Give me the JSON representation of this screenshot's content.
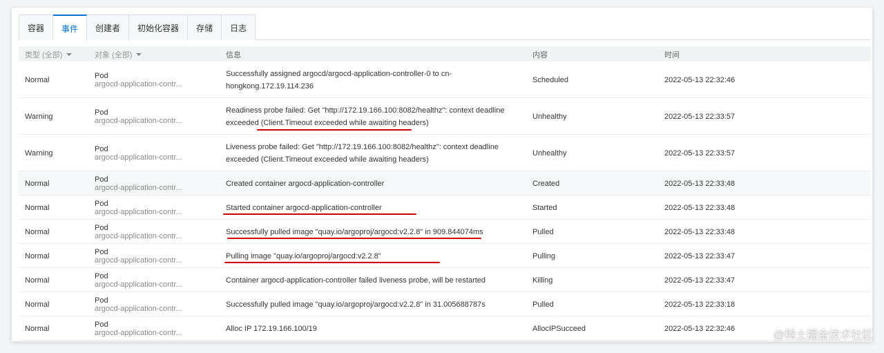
{
  "tabs": [
    {
      "label": "容器",
      "active": false
    },
    {
      "label": "事件",
      "active": true
    },
    {
      "label": "创建者",
      "active": false
    },
    {
      "label": "初始化容器",
      "active": false
    },
    {
      "label": "存储",
      "active": false
    },
    {
      "label": "日志",
      "active": false
    }
  ],
  "columns": {
    "type": "类型 (全部)",
    "object": "对象 (全部)",
    "info": "信息",
    "content": "内容",
    "time": "时间"
  },
  "events": [
    {
      "type": "Normal",
      "obj_kind": "Pod",
      "obj_name": "argocd-application-contr...",
      "info_line1": "Successfully assigned argocd/argocd-application-controller-0 to cn-",
      "info_line2": "hongkong.172.19.114.236",
      "content": "Scheduled",
      "time": "2022-05-13 22:32:46"
    },
    {
      "type": "Warning",
      "obj_kind": "Pod",
      "obj_name": "argocd-application-contr...",
      "info_line1": "Readiness probe failed: Get \"http://172.19.166.100:8082/healthz\": context deadline",
      "info_line2": "exceeded (Client.Timeout exceeded while awaiting headers)",
      "content": "Unhealthy",
      "time": "2022-05-13 22:33:57"
    },
    {
      "type": "Warning",
      "obj_kind": "Pod",
      "obj_name": "argocd-application-contr...",
      "info_line1": "Liveness probe failed: Get \"http://172.19.166.100:8082/healthz\": context deadline",
      "info_line2": "exceeded (Client.Timeout exceeded while awaiting headers)",
      "content": "Unhealthy",
      "time": "2022-05-13 22:33:57"
    },
    {
      "type": "Normal",
      "obj_kind": "Pod",
      "obj_name": "argocd-application-contr...",
      "info_line1": "Created container argocd-application-controller",
      "info_line2": "",
      "content": "Created",
      "time": "2022-05-13 22:33:48"
    },
    {
      "type": "Normal",
      "obj_kind": "Pod",
      "obj_name": "argocd-application-contr...",
      "info_line1": "Started container argocd-application-controller",
      "info_line2": "",
      "content": "Started",
      "time": "2022-05-13 22:33:48"
    },
    {
      "type": "Normal",
      "obj_kind": "Pod",
      "obj_name": "argocd-application-contr...",
      "info_line1": "Successfully pulled image \"quay.io/argoproj/argocd:v2.2.8\" in 909.844074ms",
      "info_line2": "",
      "content": "Pulled",
      "time": "2022-05-13 22:33:48"
    },
    {
      "type": "Normal",
      "obj_kind": "Pod",
      "obj_name": "argocd-application-contr...",
      "info_line1": "Pulling image \"quay.io/argoproj/argocd:v2.2.8\"",
      "info_line2": "",
      "content": "Pulling",
      "time": "2022-05-13 22:33:47"
    },
    {
      "type": "Normal",
      "obj_kind": "Pod",
      "obj_name": "argocd-application-contr...",
      "info_line1": "Container argocd-application-controller failed liveness probe, will be restarted",
      "info_line2": "",
      "content": "Killing",
      "time": "2022-05-13 22:33:47"
    },
    {
      "type": "Normal",
      "obj_kind": "Pod",
      "obj_name": "argocd-application-contr...",
      "info_line1": "Successfully pulled image \"quay.io/argoproj/argocd:v2.2.8\" in 31.005688787s",
      "info_line2": "",
      "content": "Pulled",
      "time": "2022-05-13 22:33:18"
    },
    {
      "type": "Normal",
      "obj_kind": "Pod",
      "obj_name": "argocd-application-contr...",
      "info_line1": "Alloc IP 172.19.166.100/19",
      "info_line2": "",
      "content": "AllocIPSucceed",
      "time": "2022-05-13 22:32:46"
    }
  ],
  "annotation_color": "#cc0000",
  "watermark": "@稀土掘金技术社区"
}
